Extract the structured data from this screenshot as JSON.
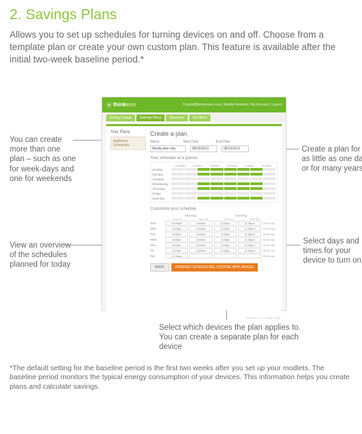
{
  "title": "2. Savings Plans",
  "intro": "Allows you to set up schedules for turning devices on and off. Choose from a template plan or create your own custom plan. This feature is available after the initial two-week baseline period.*",
  "app": {
    "brand_think": "think",
    "brand_eco": "eco",
    "header_links": "Hi jack@thinkecoinc.com | Modlet Network | My Account | Logout",
    "tabs": [
      "Energy Usage",
      "Savings Plans",
      "Summary",
      "Get More"
    ],
    "side_heading": "Your Plans",
    "side_item": "Appliance Schedules",
    "create_heading": "Create a plan",
    "labels": {
      "name": "Name",
      "start": "Start Date",
      "end": "End Date"
    },
    "values": {
      "name": "Media plan one",
      "start": "08/15/2011",
      "end": "08/31/2011"
    },
    "glance_heading": "Your schedule at a glance",
    "hours": [
      "12:00am",
      "4:00am",
      "8:00am",
      "12:00pm",
      "4:00pm",
      "8:00pm"
    ],
    "days": [
      "Sunday",
      "Monday",
      "Tuesday",
      "Wednesday",
      "Thursday",
      "Friday",
      "Saturday"
    ],
    "on_pattern": [
      [
        0,
        0,
        1,
        1,
        1,
        1,
        1,
        0
      ],
      [
        0,
        0,
        1,
        1,
        1,
        1,
        1,
        0
      ],
      [
        0,
        0,
        0,
        0,
        0,
        0,
        0,
        0
      ],
      [
        0,
        0,
        1,
        1,
        1,
        1,
        1,
        0
      ],
      [
        0,
        0,
        1,
        1,
        1,
        1,
        1,
        0
      ],
      [
        0,
        0,
        0,
        0,
        0,
        0,
        0,
        0
      ],
      [
        0,
        0,
        1,
        1,
        1,
        1,
        1,
        0
      ]
    ],
    "customize_heading": "Customize your schedule",
    "groups": [
      "Morning",
      "Evening"
    ],
    "subcols": [
      "Turn on",
      "Turn off",
      "Turn on",
      "Turn off"
    ],
    "off_label": "Off all day",
    "days_short": [
      "Sun",
      "Mon",
      "Tue",
      "Wed",
      "Thu",
      "Fri",
      "Sat"
    ],
    "cells": [
      [
        "12:00am",
        "8:05am",
        "3:00pm",
        "11:45pm"
      ],
      [
        "5:00am",
        "8:00am",
        "3:00pm",
        "11:45pm"
      ],
      [
        "5:00am",
        "8:00am",
        "3:00pm",
        "11:45pm"
      ],
      [
        "5:00am",
        "8:00am",
        "3:00pm",
        "11:45pm"
      ],
      [
        "5:00am",
        "8:00am",
        "3:00pm",
        "11:45pm"
      ],
      [
        "5:00am",
        "8:00am",
        "3:00pm",
        "11:45pm"
      ],
      [
        "12:00am",
        "",
        "",
        ""
      ]
    ],
    "back_label": "BACK",
    "primary_label": "FINISHED SCHEDULING, CHOOSE APPLIANCES",
    "footer": "ThinkEco v2_1.2.0004 | FAQ"
  },
  "callouts": {
    "c1": "You can create more than one plan – such as one for week-days and one for weekends",
    "c2": "Create a plan for as little as one day or for many years",
    "c3": "View an overview of the schedules planned for today",
    "c4": "Select days and times for your device to turn on",
    "c5": "Select which devices the plan applies to. You can create a separate plan for each device"
  },
  "footnote": "*The default setting for the baseline period is the first two weeks after you set up your modlets. The baseline period monitors the typical energy consumption of your devices. This information helps you create plans and calculate savings."
}
